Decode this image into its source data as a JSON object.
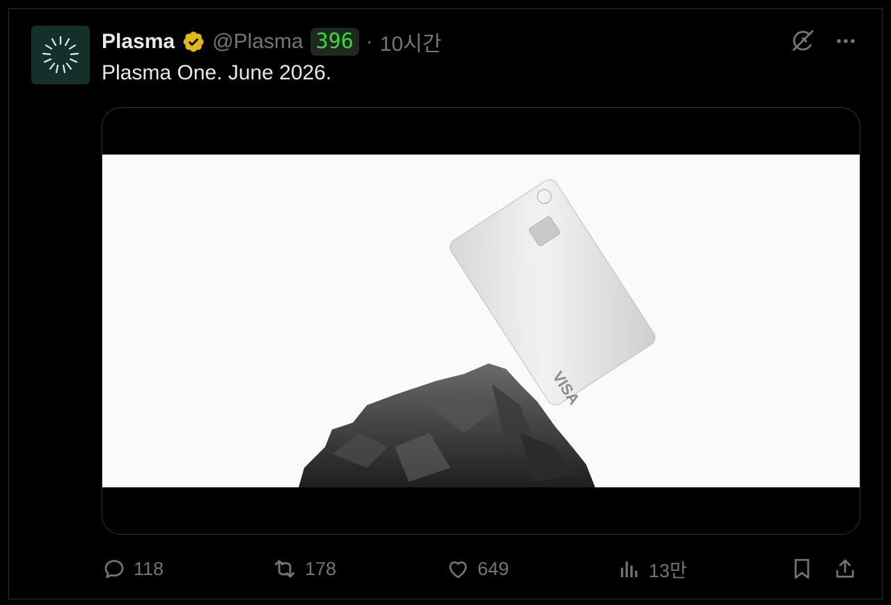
{
  "tweet": {
    "author_name": "Plasma",
    "handle": "@Plasma",
    "badge_count": "396",
    "separator": "·",
    "time": "10시간",
    "text": "Plasma One. June 2026.",
    "media": {
      "card_brand": "VISA",
      "background": "#fafafa"
    }
  },
  "actions": {
    "replies": "118",
    "retweets": "178",
    "likes": "649",
    "views": "13만"
  },
  "icons": {
    "avatar": "plasma-logo",
    "verified": "verified-badge-gold",
    "grok": "grok-icon",
    "more": "more-icon",
    "reply": "reply-icon",
    "retweet": "retweet-icon",
    "like": "heart-icon",
    "views": "views-icon",
    "bookmark": "bookmark-icon",
    "share": "share-icon"
  },
  "colors": {
    "background": "#000000",
    "text_primary": "#e7e9ea",
    "text_secondary": "#71767b",
    "verified_gold": "#e2b719",
    "badge_green": "#3dd63d"
  }
}
